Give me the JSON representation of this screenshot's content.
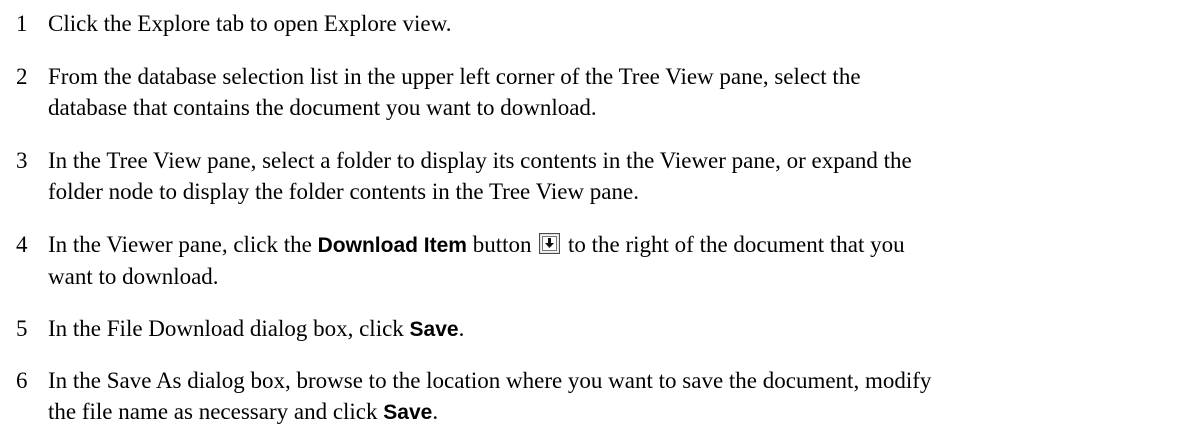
{
  "steps": [
    {
      "number": "1",
      "text": "Click the Explore tab to open Explore view."
    },
    {
      "number": "2",
      "line1": "From the database selection list in the upper left corner of the Tree View pane, select the",
      "line2": "database that contains the document you want to download."
    },
    {
      "number": "3",
      "line1": "In the Tree View pane, select a folder to display its contents in the Viewer pane, or expand the",
      "line2": "folder node to display the folder contents in the Tree View pane."
    },
    {
      "number": "4",
      "before": "In the Viewer pane, click the ",
      "ui": "Download Item",
      "middle": " button ",
      "icon": "download-item-icon",
      "after": " to the right of the document that you",
      "line2": "want to download."
    },
    {
      "number": "5",
      "before": "In the File Download dialog box, click ",
      "ui": "Save",
      "after": "."
    },
    {
      "number": "6",
      "line1": "In the Save As dialog box, browse to the location where you want to save the document, modify",
      "line2_before": "the file name as necessary and click ",
      "ui": "Save",
      "after": "."
    }
  ]
}
